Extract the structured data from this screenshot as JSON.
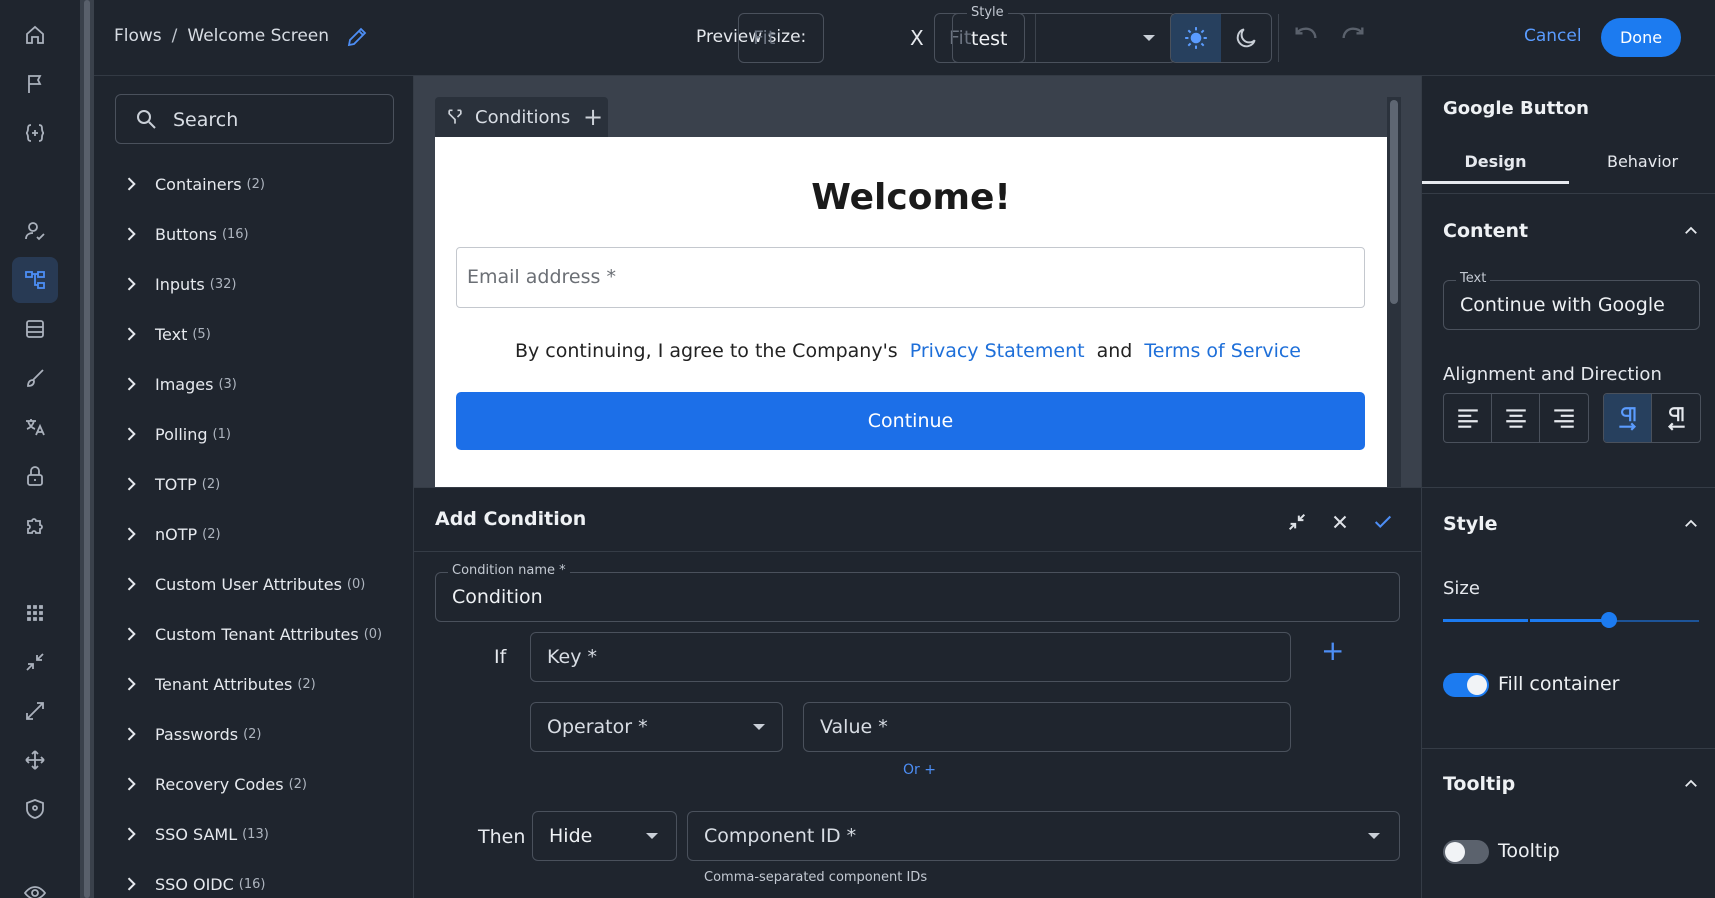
{
  "rail": {
    "icons": [
      "home-icon",
      "flag-icon",
      "brackets-plus-icon",
      "user-check-icon",
      "flows-icon",
      "table-icon",
      "brush-icon",
      "translate-icon",
      "lock-icon",
      "puzzle-icon",
      "apps-grid-icon",
      "shrink-icon",
      "expand-icon",
      "move-icon",
      "shield-icon",
      "eye-icon"
    ],
    "active": "flows-icon"
  },
  "topbar": {
    "breadcrumb_root": "Flows",
    "breadcrumb_sep": "/",
    "breadcrumb_current": "Welcome Screen",
    "preview_label": "Preview size:",
    "width_placeholder": "Fit",
    "height_placeholder": "Fit",
    "x_label": "X",
    "style_label": "Style",
    "style_value": "test",
    "cancel_label": "Cancel",
    "done_label": "Done"
  },
  "left": {
    "search_placeholder": "Search",
    "categories": [
      {
        "label": "Containers",
        "count": "(2)"
      },
      {
        "label": "Buttons",
        "count": "(16)"
      },
      {
        "label": "Inputs",
        "count": "(32)"
      },
      {
        "label": "Text",
        "count": "(5)"
      },
      {
        "label": "Images",
        "count": "(3)"
      },
      {
        "label": "Polling",
        "count": "(1)"
      },
      {
        "label": "TOTP",
        "count": "(2)"
      },
      {
        "label": "nOTP",
        "count": "(2)"
      },
      {
        "label": "Custom User Attributes",
        "count": "(0)"
      },
      {
        "label": "Custom Tenant Attributes",
        "count": "(0)"
      },
      {
        "label": "Tenant Attributes",
        "count": "(2)"
      },
      {
        "label": "Passwords",
        "count": "(2)"
      },
      {
        "label": "Recovery Codes",
        "count": "(2)"
      },
      {
        "label": "SSO SAML",
        "count": "(13)"
      },
      {
        "label": "SSO OIDC",
        "count": "(16)"
      }
    ]
  },
  "canvas": {
    "conditions_tab": "Conditions",
    "add_symbol": "+",
    "preview": {
      "heading": "Welcome!",
      "email_placeholder": "Email address *",
      "agree_text": "By continuing, I agree to the Company's",
      "privacy_link": "Privacy Statement",
      "and_text": "and",
      "terms_link": "Terms of Service",
      "continue_label": "Continue"
    }
  },
  "add_condition": {
    "title": "Add Condition",
    "name_label": "Condition name *",
    "name_value": "Condition",
    "if_label": "If",
    "key_placeholder": "Key *",
    "operator_placeholder": "Operator *",
    "value_placeholder": "Value *",
    "or_label": "Or +",
    "then_label": "Then",
    "action_value": "Hide",
    "component_placeholder": "Component ID *",
    "component_hint": "Comma-separated component IDs",
    "add_symbol": "+"
  },
  "right": {
    "title": "Google Button",
    "tabs": [
      "Design",
      "Behavior"
    ],
    "content_section": "Content",
    "text_label": "Text",
    "text_value": "Continue with Google",
    "alignment_label": "Alignment and Direction",
    "style_section": "Style",
    "size_label": "Size",
    "size_level": 0.65,
    "fill_label": "Fill container",
    "fill_on": true,
    "tooltip_section": "Tooltip",
    "tooltip_label": "Tooltip",
    "tooltip_on": false
  },
  "colors": {
    "accent": "#1c7bf0",
    "link": "#4d8ef5",
    "background": "#1f252e"
  }
}
